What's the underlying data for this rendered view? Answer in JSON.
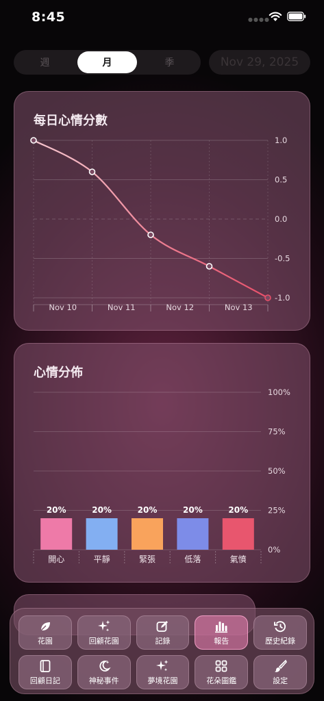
{
  "status": {
    "time": "8:45"
  },
  "period_tabs": [
    {
      "label": "週",
      "active": false
    },
    {
      "label": "月",
      "active": true
    },
    {
      "label": "季",
      "active": false
    }
  ],
  "date_label": "Nov 29, 2025",
  "mood_card": {
    "title": "每日心情分數"
  },
  "dist_card": {
    "title": "心情分佈"
  },
  "colors": {
    "line_start": "#f6c6cf",
    "line_end": "#e8506a",
    "happy": "#ee7aa8",
    "calm": "#83aff2",
    "tense": "#f9a35c",
    "down": "#7d8ce8",
    "angry": "#e8566e"
  },
  "chart_data": [
    {
      "type": "line",
      "title": "每日心情分數",
      "categories": [
        "Nov 10",
        "Nov 11",
        "Nov 12",
        "Nov 13"
      ],
      "x": [
        "Nov 10",
        "Nov 10-11",
        "Nov 11-12",
        "Nov 12-13",
        "Nov 13"
      ],
      "values": [
        1.0,
        0.6,
        -0.2,
        -0.6,
        -1.0
      ],
      "y_ticks": [
        "1.0",
        "0.5",
        "0.0",
        "-0.5",
        "-1.0"
      ],
      "ylim": [
        -1,
        1
      ],
      "grid": true,
      "axis_position": "right"
    },
    {
      "type": "bar",
      "title": "心情分佈",
      "categories": [
        "開心",
        "平靜",
        "緊張",
        "低落",
        "氣憤"
      ],
      "values": [
        20,
        20,
        20,
        20,
        20
      ],
      "value_labels": [
        "20%",
        "20%",
        "20%",
        "20%",
        "20%"
      ],
      "y_ticks": [
        "100%",
        "75%",
        "50%",
        "25%",
        "0%"
      ],
      "ylim": [
        0,
        100
      ],
      "grid": true,
      "axis_position": "right"
    }
  ],
  "nav": [
    {
      "label": "花園",
      "icon": "leaf-icon",
      "active": false
    },
    {
      "label": "回顧花園",
      "icon": "sparkles-icon",
      "active": false
    },
    {
      "label": "記錄",
      "icon": "edit-icon",
      "active": false
    },
    {
      "label": "報告",
      "icon": "bar-chart-icon",
      "active": true
    },
    {
      "label": "歷史紀錄",
      "icon": "history-icon",
      "active": false
    },
    {
      "label": "回顧日記",
      "icon": "book-icon",
      "active": false
    },
    {
      "label": "神秘事件",
      "icon": "moon-stars-icon",
      "active": false
    },
    {
      "label": "夢境花園",
      "icon": "sparkles-icon",
      "active": false
    },
    {
      "label": "花朵圖鑑",
      "icon": "grid-icon",
      "active": false
    },
    {
      "label": "設定",
      "icon": "paintbrush-icon",
      "active": false
    }
  ]
}
